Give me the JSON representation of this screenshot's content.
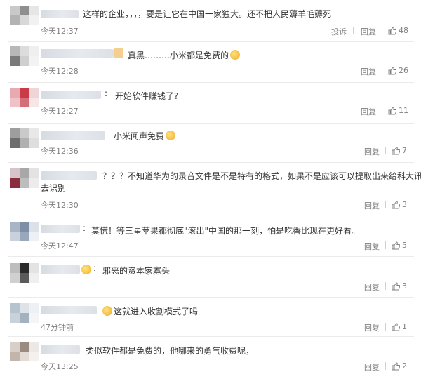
{
  "colors": {
    "text": "#333333",
    "meta": "#808080",
    "divider": "#ebebeb"
  },
  "actions": {
    "report": "投诉",
    "reply": "回复"
  },
  "comments": [
    {
      "text": "这样的企业，，，，要是让它在中国一家独大。还不把人民薅羊毛薅死",
      "time": "今天12:37",
      "likes": "48",
      "has_report": true
    },
    {
      "text": "真黑………小米都是免费的",
      "time": "今天12:28",
      "likes": "26"
    },
    {
      "text": "开始软件赚钱了?",
      "time": "今天12:27",
      "likes": "11"
    },
    {
      "text": "小米闻声免费",
      "time": "今天12:36",
      "likes": "7"
    },
    {
      "text": "？？？不知道华为的录音文件是不是特有的格式，如果不是应该可以提取出来给科大讯飞",
      "text2": "去识别",
      "time": "今天12:30",
      "likes": "3"
    },
    {
      "text": "莫慌！等三星苹果都彻底\"滚出\"中国的那一刻，怕是吃香比现在更好看。",
      "time": "今天12:47",
      "likes": "5"
    },
    {
      "text": "邪恶的资本家寡头",
      "time": "",
      "likes": "3"
    },
    {
      "text": "这就进入收割模式了吗",
      "time": "47分钟前",
      "likes": "1"
    },
    {
      "text": "类似软件都是免费的，他哪来的勇气收费呢，",
      "time": "今天13:25",
      "likes": "2"
    }
  ]
}
